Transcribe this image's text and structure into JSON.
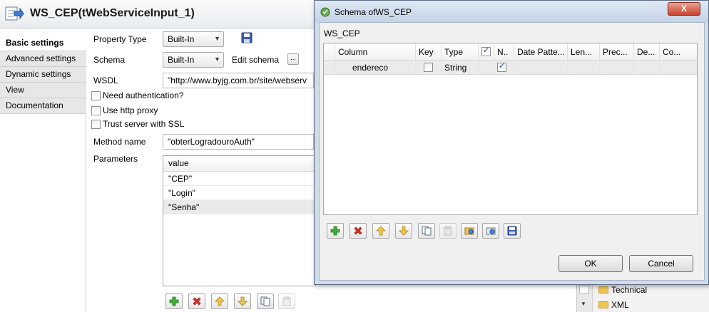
{
  "component": {
    "title": "WS_CEP(tWebServiceInput_1)"
  },
  "side_tabs": [
    {
      "label": "Basic settings",
      "active": true
    },
    {
      "label": "Advanced settings",
      "active": false
    },
    {
      "label": "Dynamic settings",
      "active": false
    },
    {
      "label": "View",
      "active": false
    },
    {
      "label": "Documentation",
      "active": false
    }
  ],
  "form": {
    "property_type_label": "Property Type",
    "property_type_value": "Built-In",
    "schema_label": "Schema",
    "schema_value": "Built-In",
    "edit_schema_label": "Edit schema",
    "edit_schema_btn": "...",
    "wsdl_label": "WSDL",
    "wsdl_value": "\"http://www.byjg.com.br/site/webserv",
    "need_auth_label": "Need authentication?",
    "http_proxy_label": "Use http proxy",
    "trust_ssl_label": "Trust server with SSL",
    "method_name_label": "Method name",
    "method_name_value": "\"obterLogradouroAuth\"",
    "parameters_label": "Parameters",
    "params_header": "value",
    "params": [
      "\"CEP\"",
      "\"Login\"",
      "\"Senha\""
    ]
  },
  "palette": {
    "items": [
      "Technical",
      "XML"
    ]
  },
  "dialog": {
    "title": "Schema ofWS_CEP",
    "close_label": "X",
    "schema_name": "WS_CEP",
    "columns": [
      "Column",
      "Key",
      "Type",
      "",
      "N..",
      "Date Patte...",
      "Len...",
      "Prec...",
      "De...",
      "Co..."
    ],
    "rows": [
      {
        "column": "endereco",
        "key": false,
        "type": "String",
        "nullable": true
      }
    ],
    "ok_label": "OK",
    "cancel_label": "Cancel"
  },
  "colors": {
    "dialog_frame": "#cfdcea",
    "close_button": "#c7432d",
    "selected_row": "#ebebeb"
  }
}
